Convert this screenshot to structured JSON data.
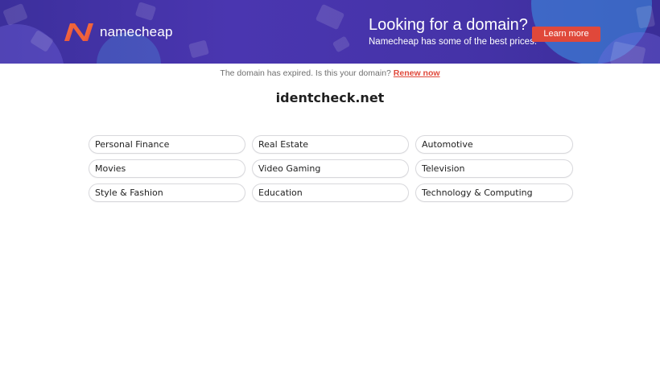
{
  "banner": {
    "brand": "namecheap",
    "headline": "Looking for a domain?",
    "subtext": "Namecheap has some of the best prices.",
    "cta_label": "Learn more",
    "colors": {
      "background": "#4533a8",
      "cta": "#e0483a",
      "logo_start": "#ff6a3d",
      "logo_end": "#e0483a"
    }
  },
  "notice": {
    "text": "The domain has expired. Is this your domain?",
    "link_label": "Renew now",
    "link_color": "#e0483a"
  },
  "domain_name": "identcheck.net",
  "categories": [
    "Personal Finance",
    "Real Estate",
    "Automotive",
    "Movies",
    "Video Gaming",
    "Television",
    "Style & Fashion",
    "Education",
    "Technology & Computing"
  ]
}
